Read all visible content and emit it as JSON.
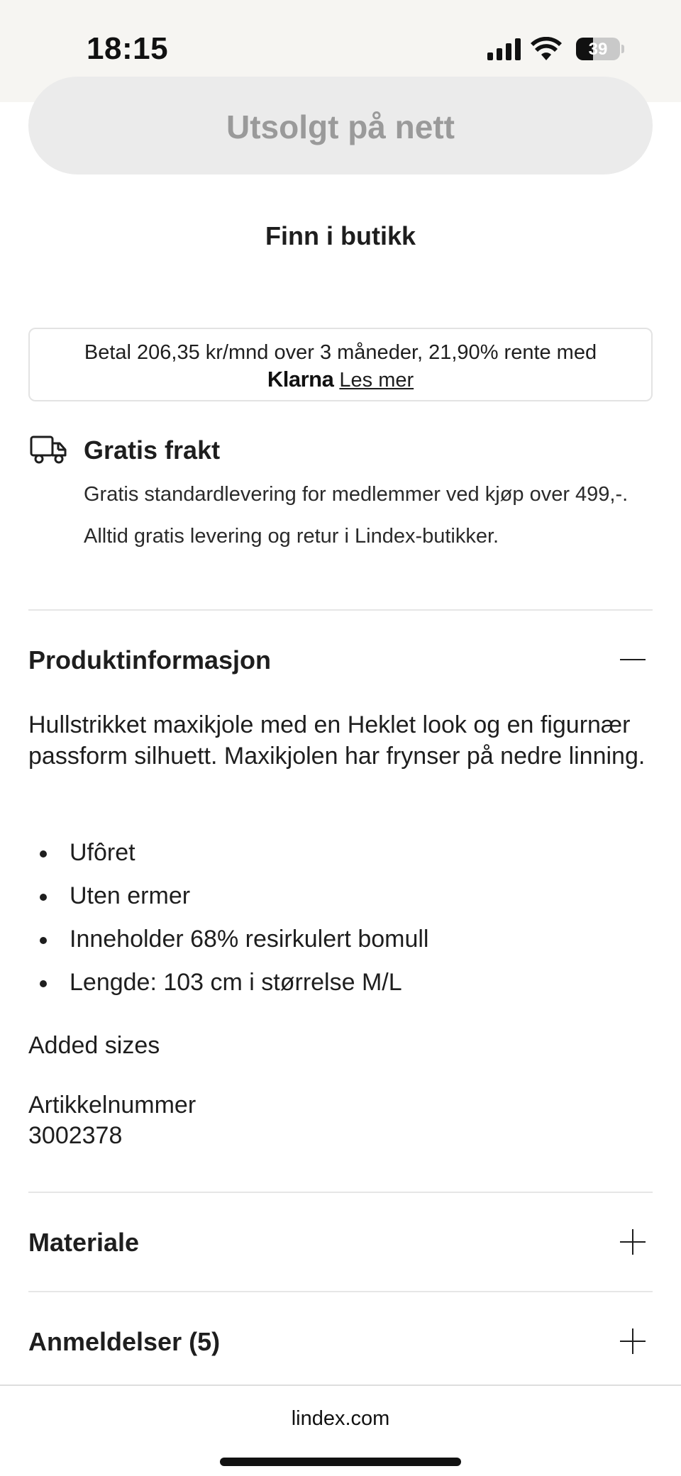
{
  "status_bar": {
    "time": "18:15",
    "battery_level": "39",
    "battery_fraction": 0.39,
    "icons": [
      "signal-icon",
      "wifi-icon",
      "battery-icon"
    ]
  },
  "product_actions": {
    "soldout_label": "Utsolgt på nett",
    "find_in_store_label": "Finn i butikk"
  },
  "klarna": {
    "text": "Betal 206,35 kr/mnd over 3 måneder, 21,90% rente med",
    "logo": "Klarna",
    "link": "Les mer"
  },
  "delivery": {
    "icon": "truck-icon",
    "title": "Gratis frakt",
    "description": "Gratis standardlevering for medlemmer ved kjøp over 499,-. Alltid gratis levering og retur i Lindex-butikker."
  },
  "product_info": {
    "title": "Produktinformasjon",
    "expanded": true,
    "description": "Hullstrikket maxikjole med en Heklet look og en figurnær passform silhuett. Maxikjolen har frynser på nedre linning.",
    "bullets": [
      "Ufôret",
      "Uten ermer",
      "Inneholder 68% resirkulert bomull",
      "Lengde: 103 cm i størrelse M/L"
    ],
    "added_sizes": "Added sizes",
    "article_label": "Artikkelnummer",
    "article_number": "3002378"
  },
  "material": {
    "title": "Materiale",
    "expanded": false
  },
  "reviews": {
    "title": "Anmeldelser (5)",
    "expanded": false
  },
  "browser": {
    "url": "lindex.com"
  },
  "colors": {
    "status_bar_bg": "#f6f5f2",
    "button_bg": "#ebebeb",
    "button_text": "#9a9a9a",
    "text": "#1e1e1e",
    "divider": "#e6e6e6"
  }
}
